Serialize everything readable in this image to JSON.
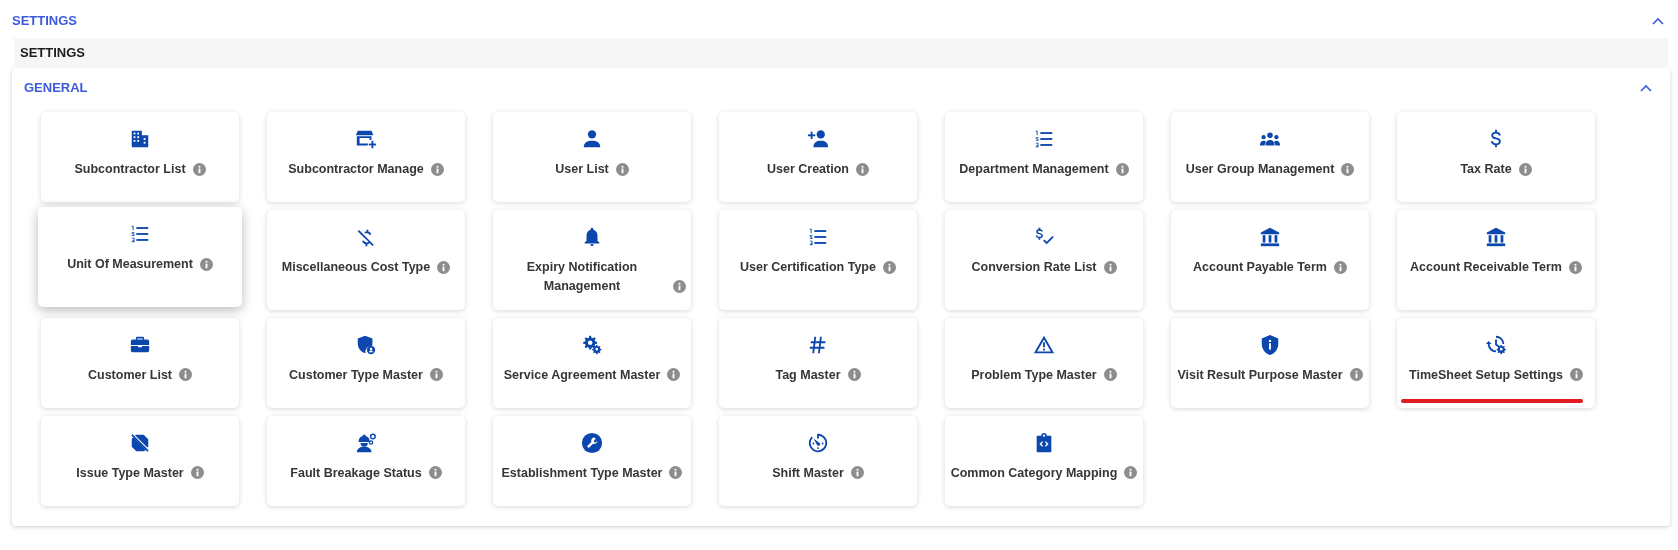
{
  "header": {
    "title": "SETTINGS",
    "expanded": true
  },
  "subheader": {
    "title": "SETTINGS"
  },
  "section": {
    "title": "GENERAL",
    "expanded": true,
    "tiles": [
      {
        "label": "Subcontractor List",
        "hovered": false,
        "highlighted": false
      },
      {
        "label": "Subcontractor Manage",
        "hovered": false,
        "highlighted": false
      },
      {
        "label": "User List",
        "hovered": false,
        "highlighted": false
      },
      {
        "label": "User Creation",
        "hovered": false,
        "highlighted": false
      },
      {
        "label": "Department Management",
        "hovered": false,
        "highlighted": false
      },
      {
        "label": "User Group Management",
        "hovered": false,
        "highlighted": false
      },
      {
        "label": "Tax Rate",
        "hovered": false,
        "highlighted": false
      },
      {
        "label": "Unit Of Measurement",
        "hovered": true,
        "highlighted": false
      },
      {
        "label": "Miscellaneous Cost Type",
        "hovered": false,
        "highlighted": false
      },
      {
        "label": "Expiry Notification Management",
        "hovered": false,
        "highlighted": false
      },
      {
        "label": "User Certification Type",
        "hovered": false,
        "highlighted": false
      },
      {
        "label": "Conversion Rate List",
        "hovered": false,
        "highlighted": false
      },
      {
        "label": "Account Payable Term",
        "hovered": false,
        "highlighted": false
      },
      {
        "label": "Account Receivable Term",
        "hovered": false,
        "highlighted": false
      },
      {
        "label": "Customer List",
        "hovered": false,
        "highlighted": false
      },
      {
        "label": "Customer Type Master",
        "hovered": false,
        "highlighted": false
      },
      {
        "label": "Service Agreement Master",
        "hovered": false,
        "highlighted": false
      },
      {
        "label": "Tag Master",
        "hovered": false,
        "highlighted": false
      },
      {
        "label": "Problem Type Master",
        "hovered": false,
        "highlighted": false
      },
      {
        "label": "Visit Result Purpose Master",
        "hovered": false,
        "highlighted": false
      },
      {
        "label": "TimeSheet Setup Settings",
        "hovered": false,
        "highlighted": true
      },
      {
        "label": "Issue Type Master",
        "hovered": false,
        "highlighted": false
      },
      {
        "label": "Fault Breakage Status",
        "hovered": false,
        "highlighted": false
      },
      {
        "label": "Establishment Type Master",
        "hovered": false,
        "highlighted": false
      },
      {
        "label": "Shift Master",
        "hovered": false,
        "highlighted": false
      },
      {
        "label": "Common Category Mapping",
        "hovered": false,
        "highlighted": false
      }
    ]
  }
}
